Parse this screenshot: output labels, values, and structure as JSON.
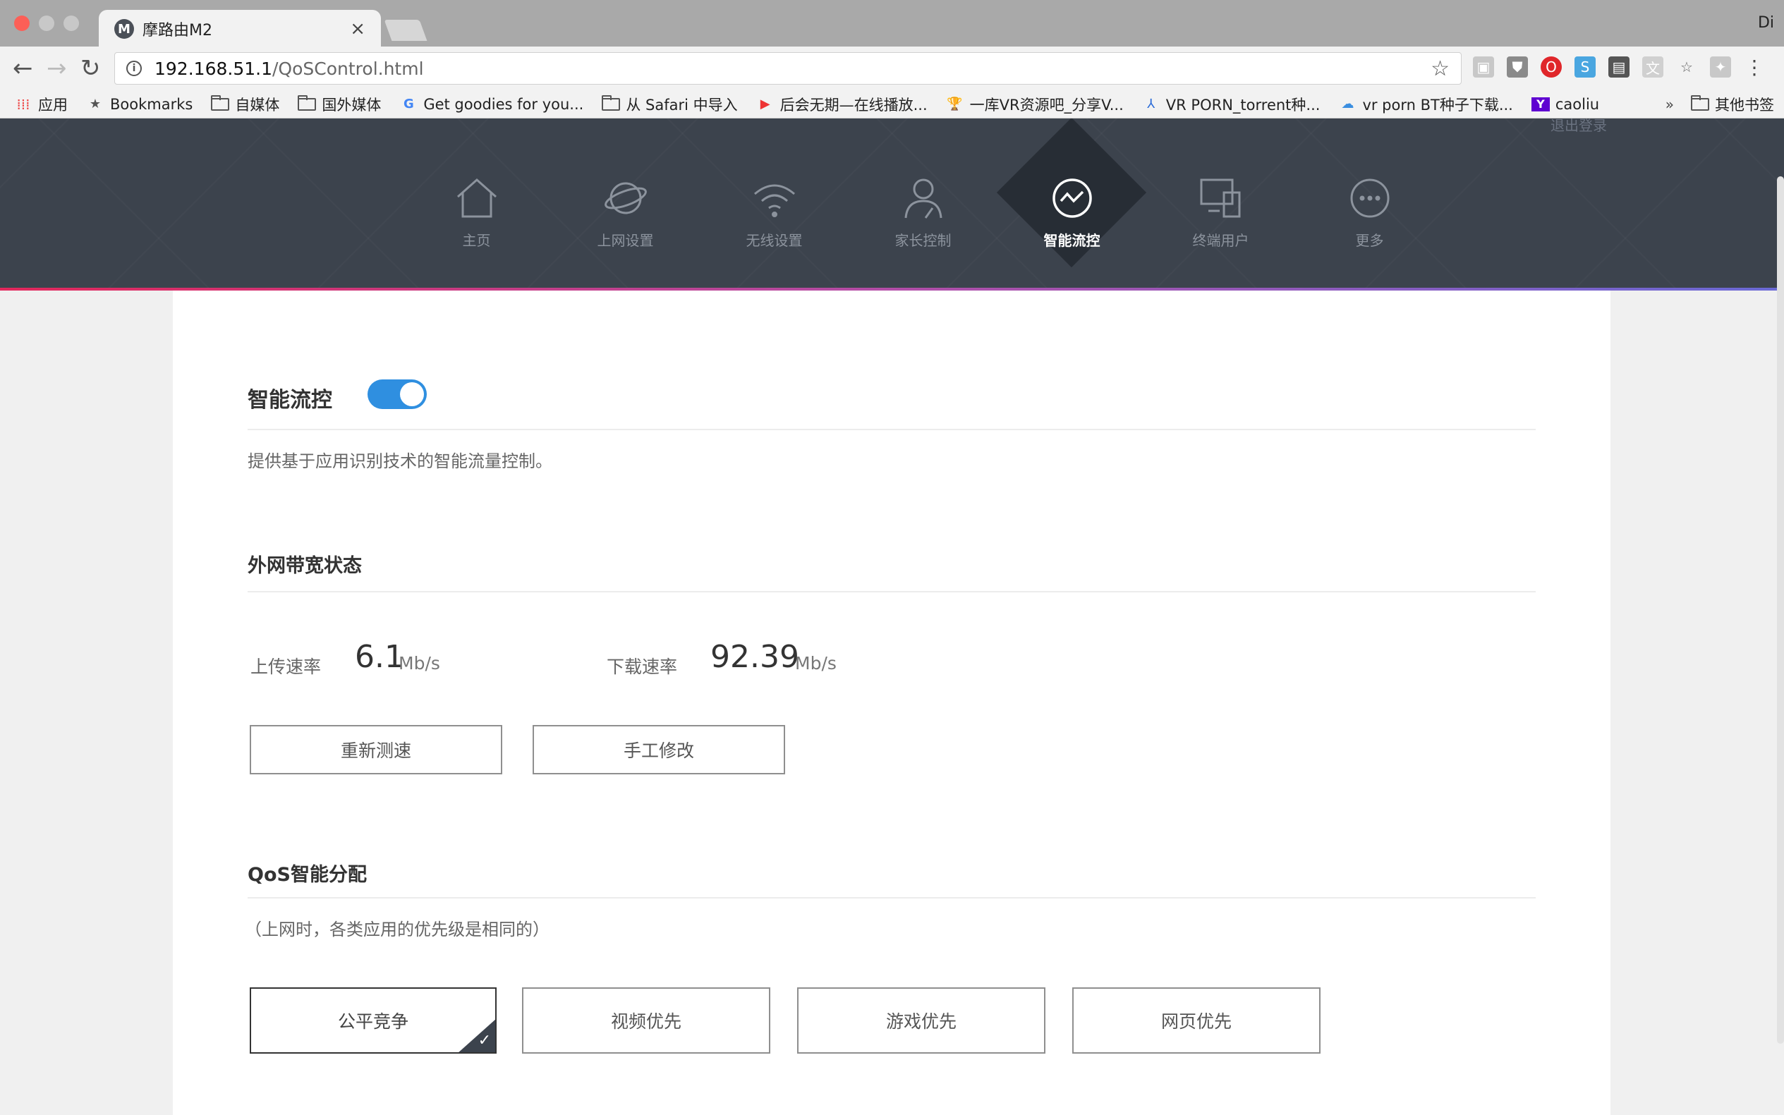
{
  "browser": {
    "tab_title": "摩路由M2",
    "favicon_letter": "M",
    "url_host": "192.168.51.1",
    "url_path": "/QoSControl.html",
    "window_user": "Di"
  },
  "bookmarks": {
    "items": [
      {
        "label": "应用",
        "icon": "apps-grid-icon"
      },
      {
        "label": "Bookmarks",
        "icon": "star-icon"
      },
      {
        "label": "自媒体",
        "icon": "folder-icon"
      },
      {
        "label": "国外媒体",
        "icon": "folder-icon"
      },
      {
        "label": "Get goodies for you...",
        "icon": "google-icon"
      },
      {
        "label": "从 Safari 中导入",
        "icon": "folder-icon"
      },
      {
        "label": "后会无期—在线播放...",
        "icon": "play-icon"
      },
      {
        "label": "一库VR资源吧_分享V...",
        "icon": "trophy-icon"
      },
      {
        "label": "VR PORN_torrent种...",
        "icon": "person-icon"
      },
      {
        "label": "vr porn BT种子下载...",
        "icon": "cloud-icon"
      },
      {
        "label": "caoliu",
        "icon": "yahoo-icon"
      }
    ],
    "overflow": "»",
    "other": "其他书签"
  },
  "router": {
    "logout": "退出登录",
    "nav": [
      {
        "label": "主页",
        "icon": "home-icon"
      },
      {
        "label": "上网设置",
        "icon": "planet-icon"
      },
      {
        "label": "无线设置",
        "icon": "wifi-icon"
      },
      {
        "label": "家长控制",
        "icon": "parent-icon"
      },
      {
        "label": "智能流控",
        "icon": "qos-icon",
        "active": true
      },
      {
        "label": "终端用户",
        "icon": "devices-icon"
      },
      {
        "label": "更多",
        "icon": "more-icon"
      }
    ]
  },
  "qos": {
    "title": "智能流控",
    "enabled": true,
    "description": "提供基于应用识别技术的智能流量控制。",
    "bandwidth_title": "外网带宽状态",
    "upload_label": "上传速率",
    "upload_value": "6.1",
    "upload_unit": "Mb/s",
    "download_label": "下载速率",
    "download_value": "92.39",
    "download_unit": "Mb/s",
    "retest_button": "重新测速",
    "manual_button": "手工修改",
    "dist_title": "QoS智能分配",
    "dist_note": "（上网时，各类应用的优先级是相同的）",
    "modes": [
      "公平竞争",
      "视频优先",
      "游戏优先",
      "网页优先"
    ],
    "selected_mode": "公平竞争"
  },
  "colors": {
    "header_bg": "#3c434d",
    "toggle_on": "#2f8fe0",
    "accent_start": "#e2285c",
    "accent_end": "#6a6ad6"
  }
}
